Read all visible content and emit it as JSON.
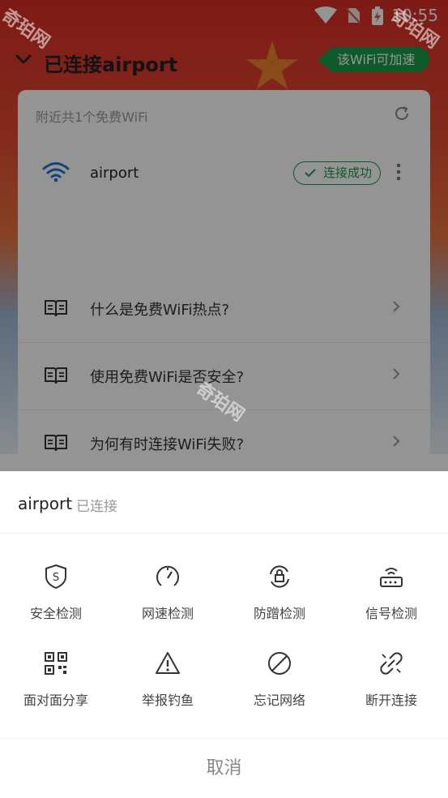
{
  "status_bar": {
    "time": "10:55"
  },
  "header": {
    "back_icon": "chevron-down-icon",
    "title": "已连接airport",
    "speedup_label": "该WiFi可加速"
  },
  "card": {
    "nearby_text": "附近共1个免费WiFi",
    "network": {
      "name": "airport",
      "status": "连接成功"
    },
    "faqs": [
      "什么是免费WiFi热点?",
      "使用免费WiFi是否安全?",
      "为何有时连接WiFi失败?"
    ]
  },
  "watermark": "奇珀网",
  "sheet": {
    "network_name": "airport",
    "connection_status": "已连接",
    "actions": [
      {
        "label": "安全检测",
        "icon": "shield-s-icon"
      },
      {
        "label": "网速检测",
        "icon": "speedometer-icon"
      },
      {
        "label": "防蹭检测",
        "icon": "lock-refresh-icon"
      },
      {
        "label": "信号检测",
        "icon": "router-icon"
      },
      {
        "label": "面对面分享",
        "icon": "qr-code-icon"
      },
      {
        "label": "举报钓鱼",
        "icon": "warning-icon"
      },
      {
        "label": "忘记网络",
        "icon": "forbidden-icon"
      },
      {
        "label": "断开连接",
        "icon": "broken-link-icon"
      }
    ],
    "cancel_label": "取消"
  },
  "colors": {
    "accent_green": "#1a9c4a",
    "wifi_blue": "#1e73d4",
    "header_red": "#d92e26"
  }
}
